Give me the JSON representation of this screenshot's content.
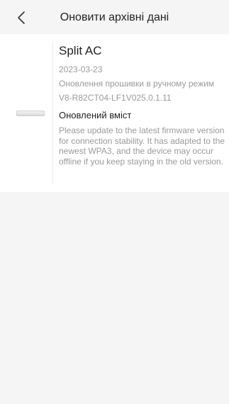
{
  "header": {
    "title": "Оновити архівні дані",
    "back_icon": "chevron-left-icon"
  },
  "firmware": {
    "device_name": "Split AC",
    "date": "2023-03-23",
    "update_type": "Оновлення прошивки в ручному режим",
    "version": "V8-R82CT04-LF1V025.0.1.11",
    "section_title": "Оновлений вміст",
    "notes": "Please update to the latest firmware version for connection stability. It has adapted to the newest WPA3, and the device may occur offline if you keep staying in the old version."
  }
}
